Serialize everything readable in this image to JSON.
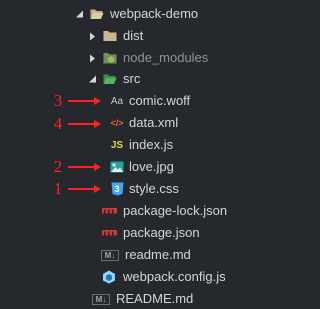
{
  "colors": {
    "background": "#25282c",
    "text": "#d6d6d6",
    "dim_text": "#8e9196",
    "annotation": "#ff2020"
  },
  "tree": {
    "root": {
      "label": "webpack-demo",
      "expanded": true,
      "icon": "folder-open-icon"
    },
    "dist": {
      "label": "dist",
      "expanded": false,
      "icon": "folder-icon"
    },
    "node_modules": {
      "label": "node_modules",
      "expanded": false,
      "icon": "node-folder-icon"
    },
    "src": {
      "label": "src",
      "expanded": true,
      "icon": "src-folder-icon"
    },
    "files": {
      "comic_woff": {
        "label": "comic.woff",
        "icon_text": "Aa"
      },
      "data_xml": {
        "label": "data.xml",
        "icon_text": "</>"
      },
      "index_js": {
        "label": "index.js",
        "icon_text": "JS"
      },
      "love_jpg": {
        "label": "love.jpg",
        "icon": "image-icon"
      },
      "style_css": {
        "label": "style.css",
        "icon_text": "3"
      },
      "package_lock": {
        "label": "package-lock.json",
        "icon": "npm-icon"
      },
      "package_json": {
        "label": "package.json",
        "icon": "npm-icon"
      },
      "readme_md": {
        "label": "readme.md",
        "icon_text": "M↓"
      },
      "webpack_config": {
        "label": "webpack.config.js",
        "icon": "webpack-icon"
      },
      "readme_upper": {
        "label": "README.md",
        "icon_text": "M↓"
      }
    }
  },
  "annotations": {
    "n1": "1",
    "n2": "2",
    "n3": "3",
    "n4": "4"
  }
}
